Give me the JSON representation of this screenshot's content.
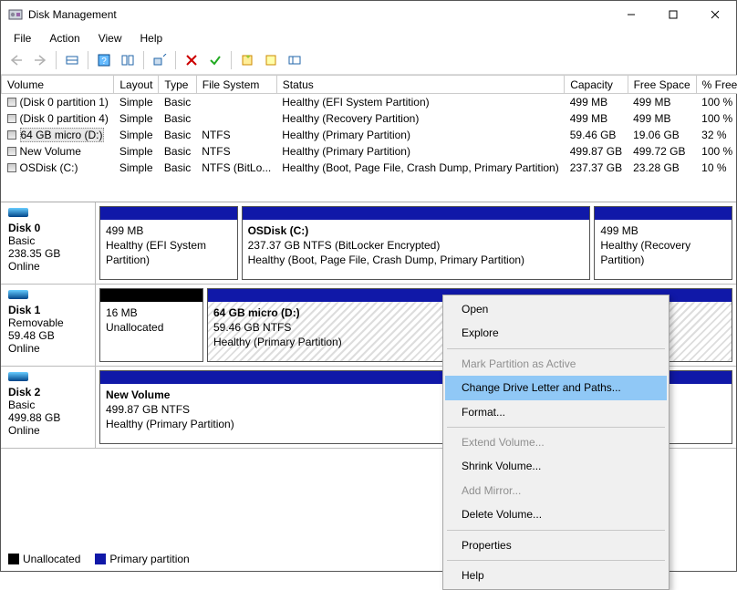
{
  "window": {
    "title": "Disk Management"
  },
  "menubar": [
    "File",
    "Action",
    "View",
    "Help"
  ],
  "columns": [
    "Volume",
    "Layout",
    "Type",
    "File System",
    "Status",
    "Capacity",
    "Free Space",
    "% Free"
  ],
  "volumes": [
    {
      "name": "(Disk 0 partition 1)",
      "layout": "Simple",
      "type": "Basic",
      "fs": "",
      "status": "Healthy (EFI System Partition)",
      "cap": "499 MB",
      "free": "499 MB",
      "pct": "100 %",
      "selected": false
    },
    {
      "name": "(Disk 0 partition 4)",
      "layout": "Simple",
      "type": "Basic",
      "fs": "",
      "status": "Healthy (Recovery Partition)",
      "cap": "499 MB",
      "free": "499 MB",
      "pct": "100 %",
      "selected": false
    },
    {
      "name": "64 GB micro (D:)",
      "layout": "Simple",
      "type": "Basic",
      "fs": "NTFS",
      "status": "Healthy (Primary Partition)",
      "cap": "59.46 GB",
      "free": "19.06 GB",
      "pct": "32 %",
      "selected": true
    },
    {
      "name": "New Volume",
      "layout": "Simple",
      "type": "Basic",
      "fs": "NTFS",
      "status": "Healthy (Primary Partition)",
      "cap": "499.87 GB",
      "free": "499.72 GB",
      "pct": "100 %",
      "selected": false
    },
    {
      "name": "OSDisk (C:)",
      "layout": "Simple",
      "type": "Basic",
      "fs": "NTFS (BitLo...",
      "status": "Healthy (Boot, Page File, Crash Dump, Primary Partition)",
      "cap": "237.37 GB",
      "free": "23.28 GB",
      "pct": "10 %",
      "selected": false
    }
  ],
  "disks": [
    {
      "label": "Disk 0",
      "kind": "Basic",
      "size": "238.35 GB",
      "state": "Online",
      "parts": [
        {
          "title": "",
          "line1": "499 MB",
          "line2": "Healthy (EFI System Partition)",
          "flex": 22,
          "stripe": "blue",
          "hatched": false
        },
        {
          "title": "OSDisk (C:)",
          "line1": "237.37 GB NTFS (BitLocker Encrypted)",
          "line2": "Healthy (Boot, Page File, Crash Dump, Primary Partition)",
          "flex": 56,
          "stripe": "blue",
          "hatched": false
        },
        {
          "title": "",
          "line1": "499 MB",
          "line2": "Healthy (Recovery Partition)",
          "flex": 22,
          "stripe": "blue",
          "hatched": false
        }
      ]
    },
    {
      "label": "Disk 1",
      "kind": "Removable",
      "size": "59.48 GB",
      "state": "Online",
      "parts": [
        {
          "title": "",
          "line1": "16 MB",
          "line2": "Unallocated",
          "flex": 16,
          "stripe": "black",
          "hatched": false
        },
        {
          "title": "64 GB micro  (D:)",
          "line1": "59.46 GB NTFS",
          "line2": "Healthy (Primary Partition)",
          "flex": 82,
          "stripe": "blue",
          "hatched": true
        }
      ]
    },
    {
      "label": "Disk 2",
      "kind": "Basic",
      "size": "499.88 GB",
      "state": "Online",
      "parts": [
        {
          "title": "New Volume",
          "line1": "499.87 GB NTFS",
          "line2": "Healthy (Primary Partition)",
          "flex": 100,
          "stripe": "blue",
          "hatched": false
        }
      ]
    }
  ],
  "legend": {
    "unallocated": "Unallocated",
    "primary": "Primary partition"
  },
  "context_menu": [
    {
      "label": "Open",
      "enabled": true,
      "hover": false
    },
    {
      "label": "Explore",
      "enabled": true,
      "hover": false
    },
    {
      "sep": true
    },
    {
      "label": "Mark Partition as Active",
      "enabled": false,
      "hover": false
    },
    {
      "label": "Change Drive Letter and Paths...",
      "enabled": true,
      "hover": true
    },
    {
      "label": "Format...",
      "enabled": true,
      "hover": false
    },
    {
      "sep": true
    },
    {
      "label": "Extend Volume...",
      "enabled": false,
      "hover": false
    },
    {
      "label": "Shrink Volume...",
      "enabled": true,
      "hover": false
    },
    {
      "label": "Add Mirror...",
      "enabled": false,
      "hover": false
    },
    {
      "label": "Delete Volume...",
      "enabled": true,
      "hover": false
    },
    {
      "sep": true
    },
    {
      "label": "Properties",
      "enabled": true,
      "hover": false
    },
    {
      "sep": true
    },
    {
      "label": "Help",
      "enabled": true,
      "hover": false
    }
  ]
}
